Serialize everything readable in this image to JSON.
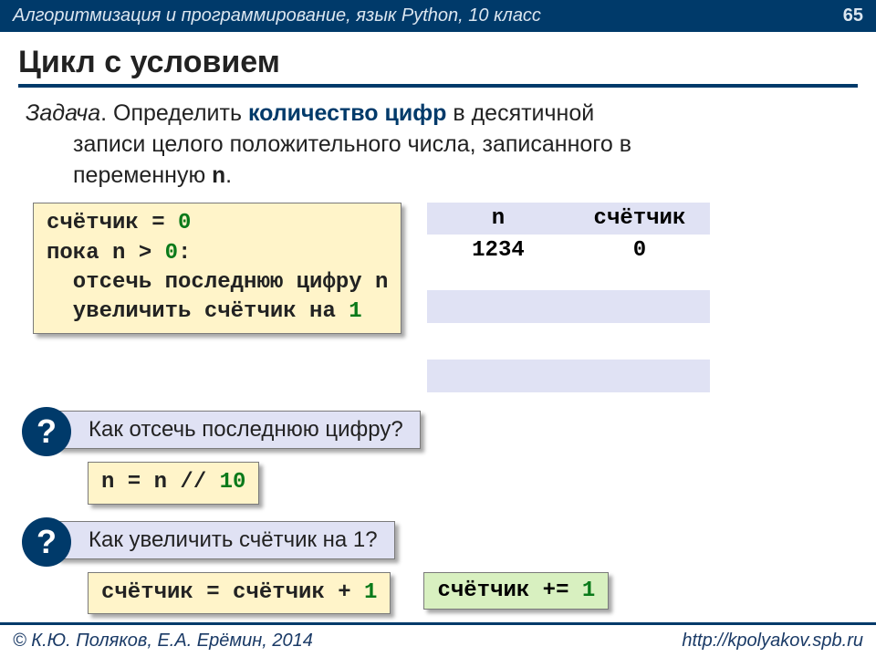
{
  "header": {
    "course": "Алгоритмизация и программирование, язык Python, 10 класс",
    "page": "65"
  },
  "title": "Цикл с условием",
  "task": {
    "lead": "Задача",
    "text1": ". Определить ",
    "bold": "количество цифр",
    "text2": " в десятичной",
    "line2": "записи целого положительного числа, записанного в",
    "line3a": "переменную ",
    "varname": "n",
    "line3b": "."
  },
  "pseudo": {
    "l1": "счётчик = ",
    "n0": "0",
    "l2a": "пока n > ",
    "l2b": ":",
    "l3": "  отсечь последнюю цифру n",
    "l4a": "  увеличить счётчик на ",
    "n1": "1"
  },
  "trace": {
    "h1": "n",
    "h2": "счётчик",
    "r1c1": "1234",
    "r1c2": "0"
  },
  "q1": {
    "mark": "?",
    "text": "Как отсечь последнюю цифру?"
  },
  "code1": {
    "pre": "n = n // ",
    "num": "10"
  },
  "q2": {
    "mark": "?",
    "text": "Как увеличить счётчик на 1?"
  },
  "code2": {
    "pre": "счётчик = счётчик + ",
    "num": "1"
  },
  "code3": {
    "pre": "счётчик += ",
    "num": "1"
  },
  "footer": {
    "authors": "© К.Ю. Поляков, Е.А. Ерёмин, 2014",
    "url": "http://kpolyakov.spb.ru"
  }
}
